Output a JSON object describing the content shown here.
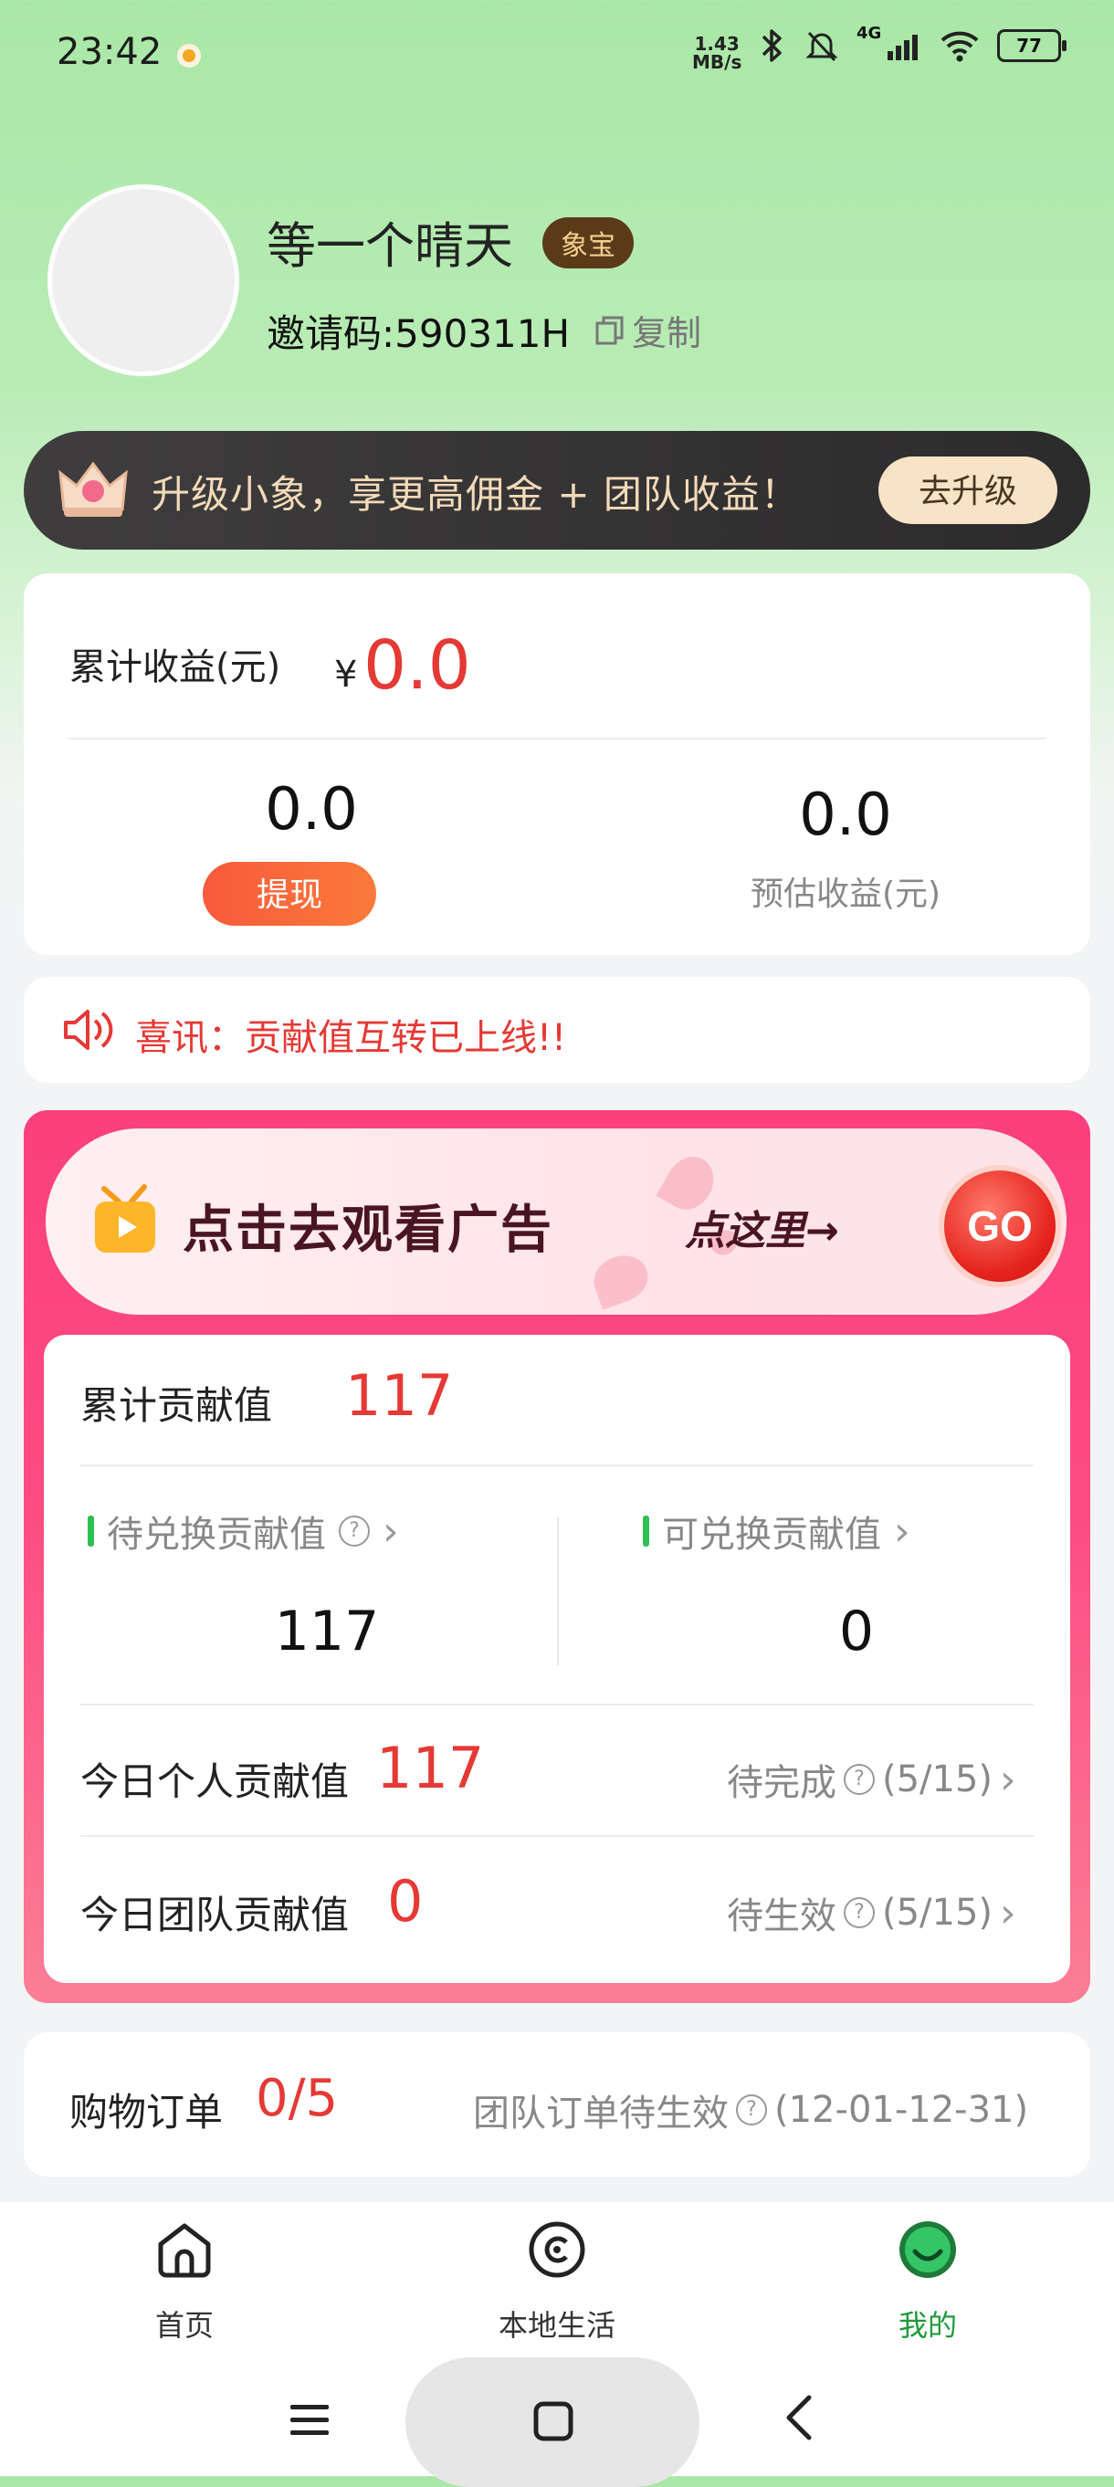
{
  "status_bar": {
    "time": "23:42",
    "net_speed_value": "1.43",
    "net_speed_unit": "MB/s",
    "signal_label": "4G",
    "battery": "77"
  },
  "profile": {
    "username": "等一个晴天",
    "badge": "象宝",
    "invite_code": "邀请码:590311H",
    "copy_label": "复制"
  },
  "upgrade_banner": {
    "text": "升级小象，享更高佣金 + 团队收益！",
    "button_label": "去升级"
  },
  "earnings": {
    "total_label": "累计收益(元)",
    "currency_symbol": "¥",
    "total_value": "0.0",
    "withdrawable_value": "0.0",
    "withdraw_button": "提现",
    "estimated_value": "0.0",
    "estimated_label": "预估收益(元)"
  },
  "announcement": {
    "text": "喜讯：贡献值互转已上线!!"
  },
  "ad_banner": {
    "text": "点击去观看广告",
    "click_text": "点这里→",
    "go_label": "GO"
  },
  "contribution": {
    "total_label": "累计贡献值",
    "total_value": "117",
    "pending_label": "待兑换贡献值",
    "pending_value": "117",
    "available_label": "可兑换贡献值",
    "available_value": "0",
    "today_personal_label": "今日个人贡献值",
    "today_personal_value": "117",
    "today_personal_status": "待完成",
    "today_personal_progress": "(5/15)",
    "today_team_label": "今日团队贡献值",
    "today_team_value": "0",
    "today_team_status": "待生效",
    "today_team_progress": "(5/15)"
  },
  "orders": {
    "label": "购物订单",
    "value": "0/5",
    "team_text": "团队订单待生效",
    "team_range": "(12-01-12-31)"
  },
  "bottom_nav": {
    "items": [
      {
        "label": "首页",
        "icon": "home-icon"
      },
      {
        "label": "本地生活",
        "icon": "local-life-icon"
      },
      {
        "label": "我的",
        "icon": "profile-icon"
      }
    ],
    "active_color": "#1e9a3a"
  },
  "colors": {
    "accent_red": "#e53935",
    "panel_pink": "#fc4c82",
    "progress_green": "#2fbf52"
  }
}
